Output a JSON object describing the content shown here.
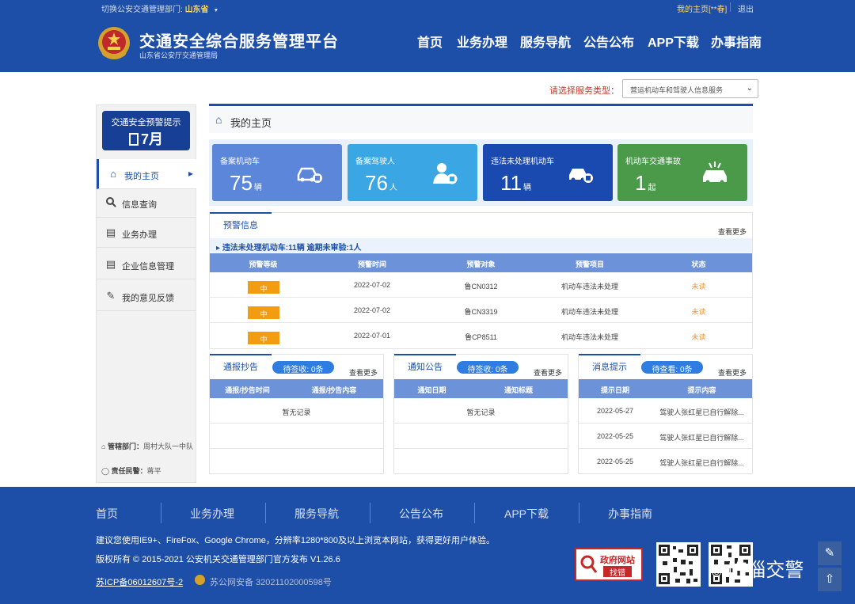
{
  "topbar": {
    "switch_label": "切换公安交通管理部门:",
    "province": "山东省",
    "province_arrow": "▼",
    "my_home": "我的主页[**春]",
    "logout": "退出"
  },
  "header": {
    "title": "交通安全综合服务管理平台",
    "subtitle": "山东省公安厅交通管理局",
    "nav": [
      "首页",
      "业务办理",
      "服务导航",
      "公告公布",
      "APP下载",
      "办事指南"
    ]
  },
  "service_type": {
    "label": "请选择服务类型：",
    "selected": "营运机动车和驾驶人信息服务"
  },
  "sidebar": {
    "warn_title": "交通安全预警提示",
    "warn_month": "7月",
    "items": [
      {
        "label": "我的主页",
        "icon": "home-icon"
      },
      {
        "label": "信息查询",
        "icon": "search-icon"
      },
      {
        "label": "业务办理",
        "icon": "stack-icon"
      },
      {
        "label": "企业信息管理",
        "icon": "document-icon"
      },
      {
        "label": "我的意见反馈",
        "icon": "feedback-icon"
      }
    ],
    "dept_label": "管辖部门：",
    "dept_value": "周村大队一中队",
    "police_label": "责任民警：",
    "police_value": "蒋平"
  },
  "page_title": "我的主页",
  "stats": [
    {
      "label": "备案机动车",
      "value": "75",
      "unit": "辆",
      "color": "#5b86d9",
      "icon": "car-badge-icon"
    },
    {
      "label": "备案驾驶人",
      "value": "76",
      "unit": "人",
      "color": "#3aa6e4",
      "icon": "driver-badge-icon"
    },
    {
      "label": "违法未处理机动车",
      "value": "11",
      "unit": "辆",
      "color": "#1a49b0",
      "icon": "car-violation-icon"
    },
    {
      "label": "机动车交通事故",
      "value": "1",
      "unit": "起",
      "color": "#4a9a4a",
      "icon": "accident-icon"
    }
  ],
  "warning": {
    "tab": "预警信息",
    "more": "查看更多",
    "alert": "违法未处理机动车:11辆   逾期未审验:1人",
    "columns": [
      "预警等级",
      "预警时间",
      "预警对象",
      "预警项目",
      "状态"
    ],
    "rows": [
      {
        "level": "中",
        "date": "2022-07-02",
        "target": "鲁CN0312",
        "item": "机动车违法未处理",
        "status": "未读"
      },
      {
        "level": "中",
        "date": "2022-07-02",
        "target": "鲁CN3319",
        "item": "机动车违法未处理",
        "status": "未读"
      },
      {
        "level": "中",
        "date": "2022-07-01",
        "target": "鲁CP8511",
        "item": "机动车违法未处理",
        "status": "未读"
      }
    ]
  },
  "report_panel": {
    "tab": "通报抄告",
    "badge": "待签收: 0条",
    "more": "查看更多",
    "columns": [
      "通报/抄告时间",
      "通报/抄告内容"
    ],
    "empty": "暂无记录"
  },
  "notice_panel": {
    "tab": "通知公告",
    "badge": "待签收: 0条",
    "more": "查看更多",
    "columns": [
      "通知日期",
      "通知标题"
    ],
    "empty": "暂无记录"
  },
  "message_panel": {
    "tab": "消息提示",
    "badge": "待查看: 0条",
    "more": "查看更多",
    "columns": [
      "提示日期",
      "提示内容"
    ],
    "rows": [
      {
        "date": "2022-05-27",
        "content": "驾驶人张红星已自行解除..."
      },
      {
        "date": "2022-05-25",
        "content": "驾驶人张红星已自行解除..."
      },
      {
        "date": "2022-05-25",
        "content": "驾驶人张红星已自行解除..."
      }
    ]
  },
  "footer": {
    "nav": [
      "首页",
      "业务办理",
      "服务导航",
      "公告公布",
      "APP下载",
      "办事指南"
    ],
    "browser_tip": "建议您使用IE9+、FireFox、Google Chrome，分辨率1280*800及以上浏览本网站，获得更好用户体验。",
    "copyright": "版权所有 © 2015-2021 公安机关交通管理部门官方发布 V1.26.6",
    "icp": "苏ICP备06012607号-2",
    "police_record": "苏公网安备 32021102000598号",
    "gov_site": "政府网站",
    "gov_find": "找错",
    "watermark": "临淄交警"
  }
}
